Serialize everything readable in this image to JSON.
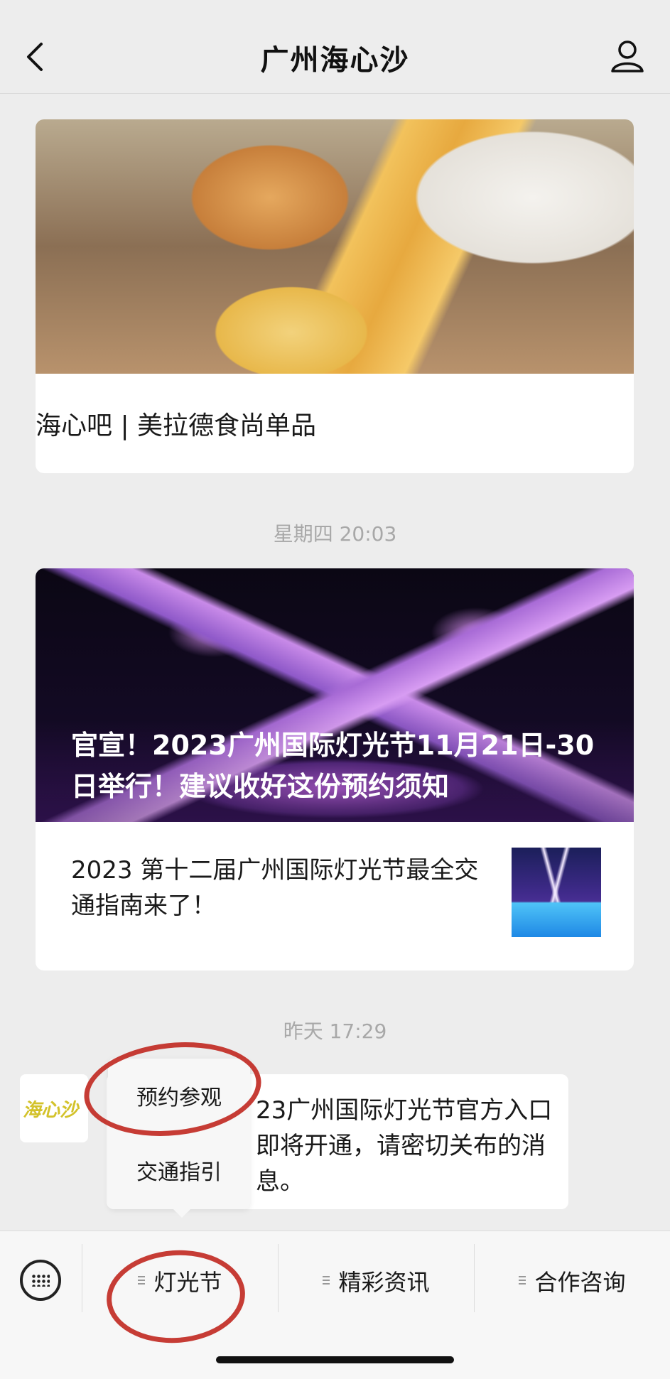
{
  "header": {
    "title": "广州海心沙",
    "back_icon": "chevron-left-icon",
    "profile_icon": "user-icon"
  },
  "feed": {
    "card1": {
      "title": "海心吧 | 美拉德食尚单品"
    },
    "timestamp1": "星期四 20:03",
    "card2": {
      "headline": "官宣！2023广州国际灯光节11月21日-30日举行！建议收好这份预约须知",
      "sub_title": "2023 第十二届广州国际灯光节最全交通指南来了！"
    },
    "timestamp2": "昨天 17:29",
    "message": {
      "avatar_text": "海心沙",
      "text": "23广州国际灯光节官方入口即将开通，请密切关布的消息。"
    }
  },
  "submenu": {
    "items": [
      "预约参观",
      "交通指引"
    ]
  },
  "bottom_bar": {
    "keyboard_icon": "keyboard-icon",
    "tabs": [
      "灯光节",
      "精彩资讯",
      "合作咨询"
    ]
  },
  "colors": {
    "background": "#ededed",
    "annotation": "#c0271f"
  }
}
